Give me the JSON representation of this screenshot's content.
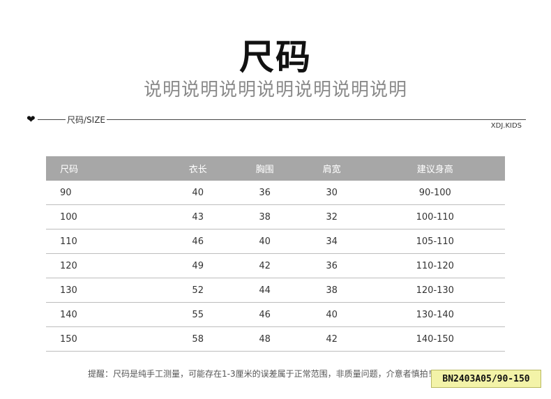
{
  "header": {
    "title": "尺码",
    "subtitle": "说明说明说明说明说明说明说明"
  },
  "size_line": {
    "heart_icon": "heart-icon",
    "label": "尺码/SIZE",
    "brand": "XDJ.KIDS"
  },
  "table": {
    "headers": [
      "尺码",
      "衣长",
      "胸围",
      "肩宽",
      "建议身高"
    ],
    "rows": [
      [
        "90",
        "40",
        "36",
        "30",
        "90-100"
      ],
      [
        "100",
        "43",
        "38",
        "32",
        "100-110"
      ],
      [
        "110",
        "46",
        "40",
        "34",
        "105-110"
      ],
      [
        "120",
        "49",
        "42",
        "36",
        "110-120"
      ],
      [
        "130",
        "52",
        "44",
        "38",
        "120-130"
      ],
      [
        "140",
        "55",
        "46",
        "40",
        "130-140"
      ],
      [
        "150",
        "58",
        "48",
        "42",
        "140-150"
      ]
    ]
  },
  "footer": {
    "note": "提醒：尺码是纯手工测量，可能存在1-3厘米的误差属于正常范围，非质量问题，介意者慎拍！",
    "code": "BN2403A05/90-150"
  },
  "colors": {
    "header_bg": "#a7a7a7",
    "badge_bg": "#f3f3a8"
  }
}
